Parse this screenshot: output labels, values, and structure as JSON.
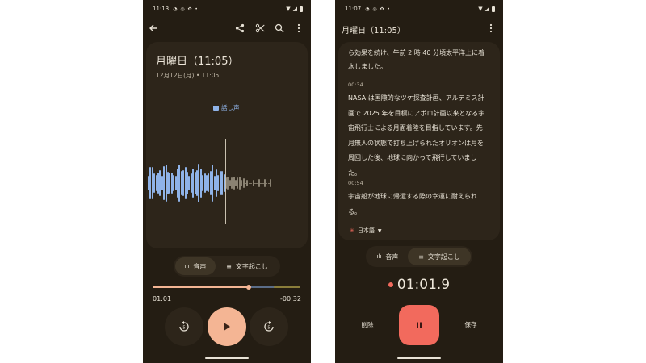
{
  "colors": {
    "background": "#241d13",
    "card": "#2d251a",
    "accent": "#f4b594",
    "waveform": "#8fb3e8",
    "record": "#f26a5d",
    "text": "#e8e2d6"
  },
  "left": {
    "status": {
      "time": "11:13"
    },
    "toolbar": {
      "icons": [
        "back-arrow-icon",
        "share-icon",
        "scissors-icon",
        "search-icon",
        "more-vert-icon"
      ]
    },
    "recording": {
      "title": "月曜日（11:05）",
      "subtitle": "12月12日(月) • 11:05",
      "speaker_label": "話し声"
    },
    "tabs": {
      "audio": "音声",
      "transcript": "文字起こし",
      "active": "audio"
    },
    "playback": {
      "elapsed": "01:01",
      "remaining": "-00:32",
      "progress": 0.65
    },
    "controls": [
      "rewind-icon",
      "play-icon",
      "forward-icon"
    ]
  },
  "right": {
    "status": {
      "time": "11:07"
    },
    "header": {
      "title": "月曜日（11:05）"
    },
    "transcript": {
      "blocks": [
        {
          "time": "",
          "text": "ら効果を続け、午前 2 時 40 分頃太平洋上に着水しました。"
        },
        {
          "time": "00:34",
          "text": "NASA は国際的なツケ探査計画、アルテミス計画で 2025 年を目標にアポロ計画以来となる宇宙飛行士による月面着陸を目指しています。先月無人の状態で打ち上げられたオリオンは月を周回した後、地球に向かって飛行していました。"
        },
        {
          "time": "00:54",
          "text": "宇宙船が地球に帰還する際の幸運に耐えられる。"
        }
      ],
      "language": "日本語"
    },
    "tabs": {
      "audio": "音声",
      "transcript": "文字起こし",
      "active": "transcript"
    },
    "timer": "01:01.9",
    "actions": {
      "delete": "削除",
      "save": "保存"
    }
  }
}
